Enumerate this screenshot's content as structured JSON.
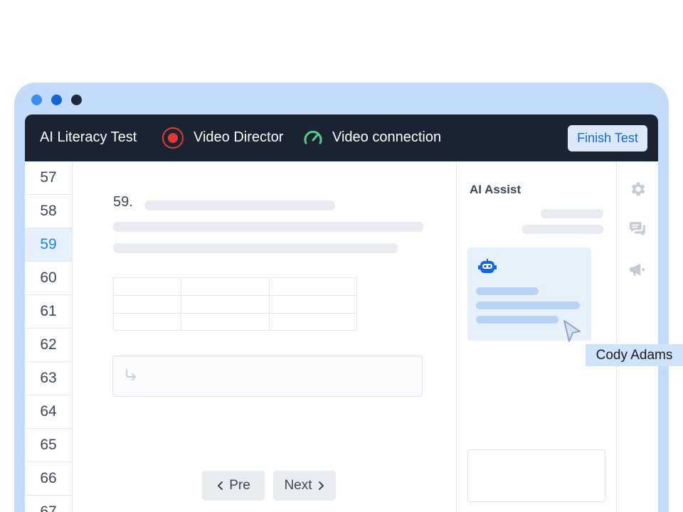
{
  "topbar": {
    "title": "AI Literacy Test",
    "video_director": "Video Director",
    "video_connection": "Video connection",
    "finish_label": "Finish Test"
  },
  "question_nav": {
    "items": [
      "57",
      "58",
      "59",
      "60",
      "61",
      "62",
      "63",
      "64",
      "65",
      "66",
      "67"
    ],
    "active": "59"
  },
  "question": {
    "number": "59."
  },
  "pager": {
    "prev_label": "Pre",
    "next_label": "Next"
  },
  "assist": {
    "title": "AI Assist"
  },
  "cursor": {
    "user_name": "Cody Adams"
  },
  "colors": {
    "topbar_bg": "#1a2332",
    "accent": "#1b84e4",
    "record": "#e53935",
    "connection_ok": "#5cc98a",
    "frame": "#c3dcfb"
  },
  "icons": [
    "record-icon",
    "gauge-icon",
    "reply-arrow-icon",
    "robot-icon",
    "gear-icon",
    "chat-icon",
    "megaphone-icon",
    "cursor-pointer-icon",
    "chevron-left-icon",
    "chevron-right-icon"
  ]
}
